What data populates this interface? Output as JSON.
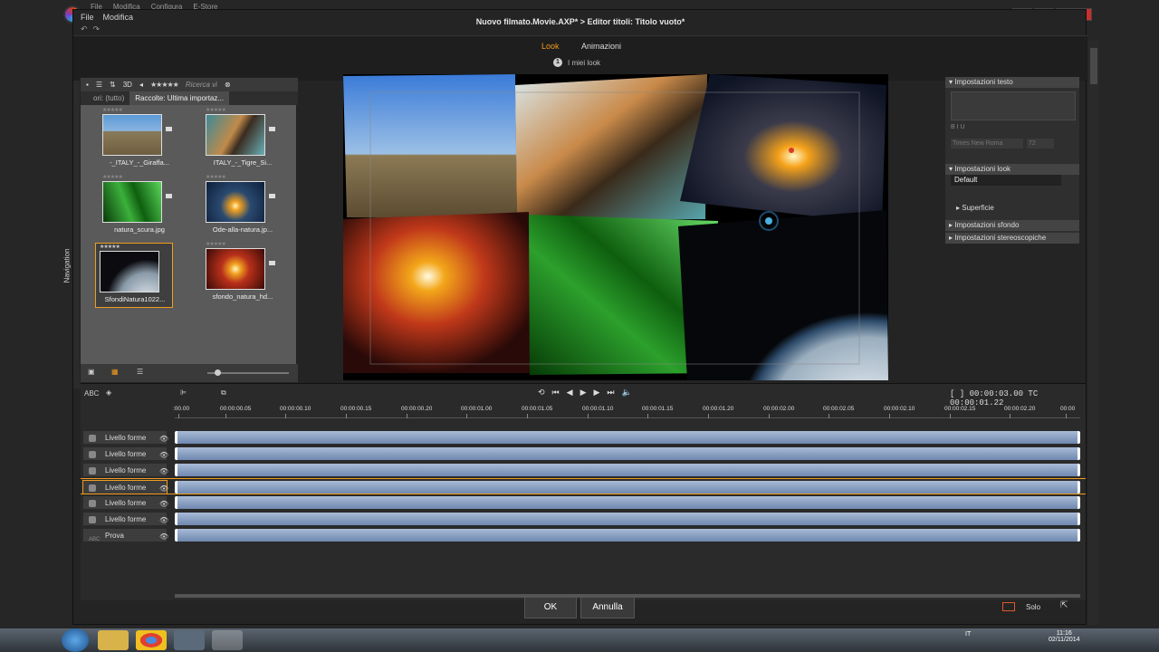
{
  "outer_menu": [
    "File",
    "Modifica",
    "Configura",
    "E-Store"
  ],
  "dialog": {
    "menu": [
      "File",
      "Modifica"
    ],
    "title": "Nuovo filmato.Movie.AXP*  >  Editor titoli: Titolo vuoto*",
    "tabs": [
      "Look",
      "Animazioni"
    ],
    "my_looks_num": "1",
    "my_looks_label": "I miei look"
  },
  "nav_label": "Navigation",
  "library": {
    "toolbar_3d": "3D",
    "stars": "★★★★★",
    "search_placeholder": "Ricerca vi",
    "tab_all": "ori: (tutto)",
    "tab_collection": "Raccolte: Ultima importaz...",
    "items": [
      {
        "caption": "-_ITALY_-_Giraffa..."
      },
      {
        "caption": "ITALY_-_Tigre_Si..."
      },
      {
        "caption": "natura_scura.jpg"
      },
      {
        "caption": "Ode-alla-natura.jp..."
      },
      {
        "caption": "SfondiNatura1022..."
      },
      {
        "caption": "sfondo_natura_hd..."
      }
    ]
  },
  "settings": {
    "text_settings": "Impostazioni testo",
    "font_buttons": "B  I  U",
    "font_name": "Times New Roma",
    "font_size": "72",
    "look_settings": "Impostazioni look",
    "look_default": "Default",
    "surface": "Superficie",
    "bg_settings": "Impostazioni sfondo",
    "stereo_settings": "Impostazioni stereoscopiche"
  },
  "timeline": {
    "abc": "ABC",
    "timecode_label": "[ ] 00:00:03.00",
    "tc": "TC",
    "tc_value": "00:00:01.22",
    "ruler_ticks": [
      ":00.00",
      "00:00:00.05",
      "00:00:00.10",
      "00:00:00.15",
      "00:00:00.20",
      "00:00:01.00",
      "00:00:01.05",
      "00:00:01.10",
      "00:00:01.15",
      "00:00:01.20",
      "00:00:02.00",
      "00:00:02.05",
      "00:00:02.10",
      "00:00:02.15",
      "00:00:02.20",
      "00:00"
    ],
    "tracks": [
      "Livello forme",
      "Livello forme",
      "Livello forme",
      "Livello forme",
      "Livello forme",
      "Livello forme",
      "Prova"
    ]
  },
  "buttons": {
    "ok": "OK",
    "cancel": "Annulla",
    "solo": "Solo"
  },
  "taskbar": {
    "lang": "IT",
    "time": "11:16",
    "date": "02/11/2014"
  },
  "colors": {
    "accent": "#f39c1b",
    "clip": "#8aa0c4"
  }
}
